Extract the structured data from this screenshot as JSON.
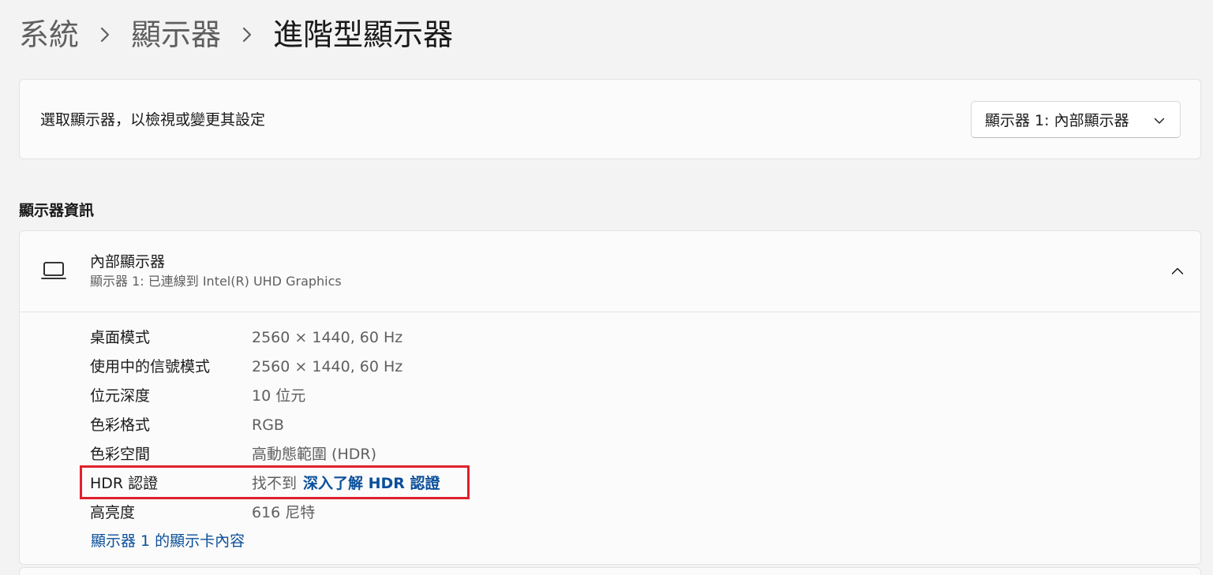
{
  "breadcrumb": {
    "items": [
      "系統",
      "顯示器"
    ],
    "current": "進階型顯示器",
    "separator_icon": "chevron-right-icon"
  },
  "display_select": {
    "label": "選取顯示器，以檢視或變更其設定",
    "selected": "顯示器 1: 內部顯示器",
    "dropdown_icon": "chevron-down-icon"
  },
  "display_info": {
    "section_title": "顯示器資訊",
    "device_icon": "laptop-icon",
    "device_name": "內部顯示器",
    "device_subtitle": "顯示器 1: 已連線到 Intel(R) UHD Graphics",
    "collapse_icon": "chevron-up-icon",
    "rows": [
      {
        "label": "桌面模式",
        "value": "2560 × 1440, 60 Hz"
      },
      {
        "label": "使用中的信號模式",
        "value": "2560 × 1440, 60 Hz"
      },
      {
        "label": "位元深度",
        "value": "10 位元"
      },
      {
        "label": "色彩格式",
        "value": "RGB"
      },
      {
        "label": "色彩空間",
        "value": "高動態範圍 (HDR)"
      },
      {
        "label": "HDR 認證",
        "value": "找不到",
        "link": "深入了解 HDR 認證"
      },
      {
        "label": "高亮度",
        "value": "616 尼特"
      }
    ],
    "adapter_link": "顯示器 1 的顯示卡內容"
  },
  "colors": {
    "background": "#f3f3f3",
    "card": "#fbfbfb",
    "link": "#0a4f99",
    "highlight": "#e0202b"
  }
}
